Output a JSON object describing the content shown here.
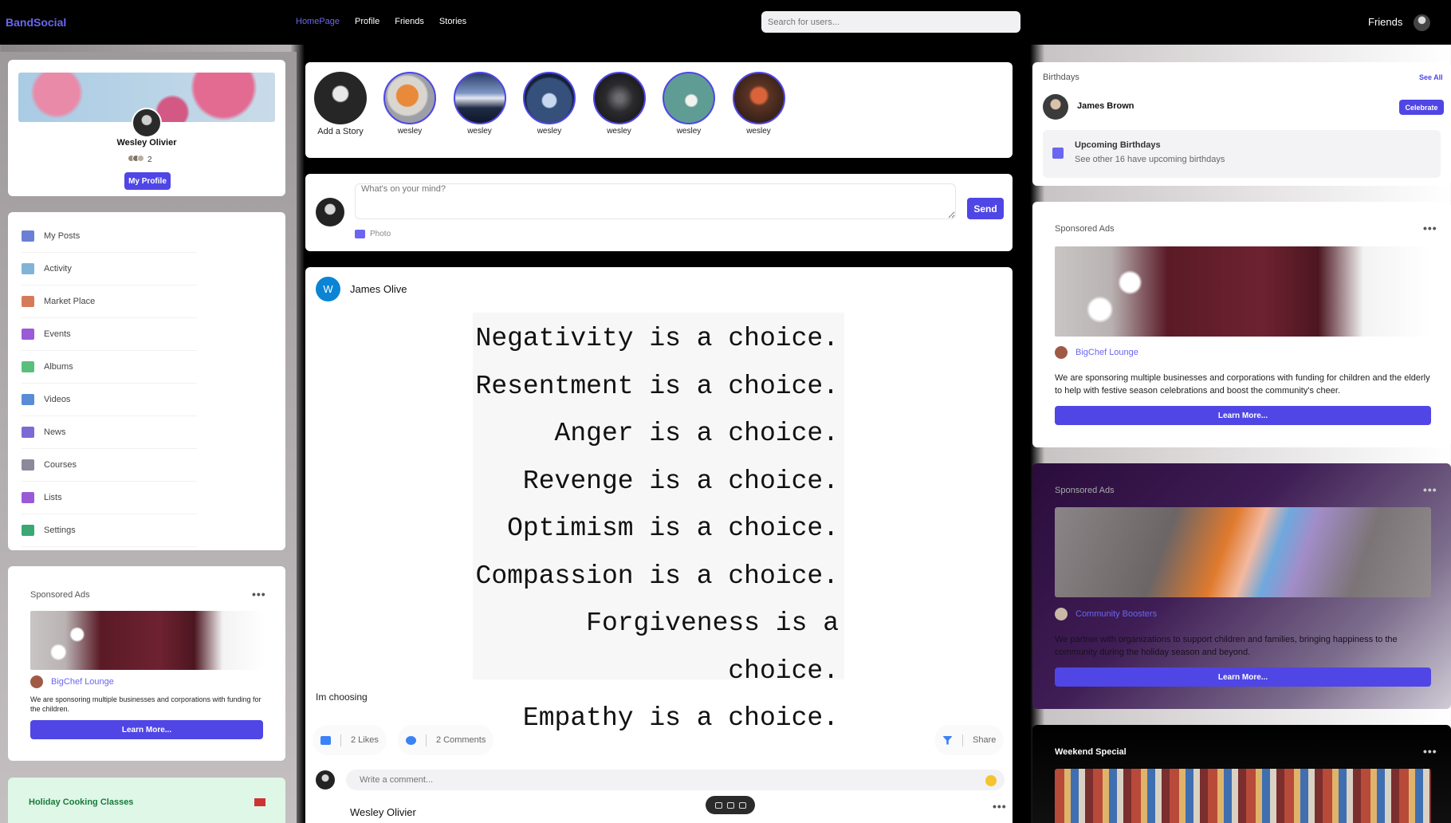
{
  "nav": {
    "brand": "BandSocial",
    "links": [
      "HomePage",
      "Profile",
      "Friends",
      "Stories"
    ],
    "search_placeholder": "Search for users...",
    "friends_label": "Friends"
  },
  "profile": {
    "name": "Wesley Olivier",
    "friend_count": "2",
    "button": "My Profile"
  },
  "menu": [
    {
      "label": "My Posts",
      "icon": "posts-icon",
      "color": "#6b7fd6"
    },
    {
      "label": "Activity",
      "icon": "activity-icon",
      "color": "#7fb4d6"
    },
    {
      "label": "Market Place",
      "icon": "marketplace-icon",
      "color": "#d67b5a"
    },
    {
      "label": "Events",
      "icon": "calendar-icon",
      "color": "#9b5ad6"
    },
    {
      "label": "Albums",
      "icon": "album-icon",
      "color": "#5abf7b"
    },
    {
      "label": "Videos",
      "icon": "video-icon",
      "color": "#5a8bd6"
    },
    {
      "label": "News",
      "icon": "news-icon",
      "color": "#7b6bd6"
    },
    {
      "label": "Courses",
      "icon": "courses-icon",
      "color": "#8a8a9a"
    },
    {
      "label": "Lists",
      "icon": "lists-icon",
      "color": "#9a5ad6"
    },
    {
      "label": "Settings",
      "icon": "settings-icon",
      "color": "#3aa873"
    }
  ],
  "left_ad": {
    "label": "Sponsored Ads",
    "brand": "BigChef Lounge",
    "text": "We are sponsoring multiple businesses and corporations with funding for the children.",
    "button": "Learn More..."
  },
  "holiday": {
    "title": "Holiday Cooking Classes"
  },
  "stories": {
    "add_label": "Add a Story",
    "items": [
      {
        "name": "wesley",
        "bg": "radial-gradient(circle at 45% 45%,#e98a3b 0 28%,#d9d5cf 30% 50%,#9c9fa6 55% 100%)"
      },
      {
        "name": "wesley",
        "bg": "linear-gradient(180deg,#2b3f6b 0,#7f96c4 40%,#e6e9f2 50%,#1f2b45 70%,#0f172a 100%)"
      },
      {
        "name": "wesley",
        "bg": "radial-gradient(circle at 50% 55%,#c7d8f0 0 18%,#35507a 22% 60%,#142239 65% 100%)"
      },
      {
        "name": "wesley",
        "bg": "radial-gradient(circle at 50% 50%,#6c6c70 0 10%,#2b2b2e 40%,#111 100%)"
      },
      {
        "name": "wesley",
        "bg": "radial-gradient(circle at 55% 55%,#f2f2ee 0 14%,#5f9c94 18% 100%)"
      },
      {
        "name": "wesley",
        "bg": "radial-gradient(circle at 50% 45%,#d9643a 0 20%,#5c3424 28%,#1f1512 100%)"
      }
    ]
  },
  "composer": {
    "placeholder": "What's on your mind?",
    "send": "Send",
    "photo": "Photo"
  },
  "post": {
    "author_initial": "W",
    "author": "James Olive",
    "quote_lines": [
      "Negativity is a choice.",
      "Resentment is a choice.",
      "Anger is a choice.",
      "Revenge is a choice.",
      "Optimism is a choice.",
      "Compassion is a choice.",
      "Forgiveness is a choice.",
      "Empathy is a choice."
    ],
    "caption": "Im choosing",
    "likes": "2 Likes",
    "comments": "2 Comments",
    "share": "Share",
    "comment_placeholder": "Write a comment...",
    "comment_author": "Wesley Olivier"
  },
  "birthdays": {
    "title": "Birthdays",
    "see_all": "See All",
    "name": "James Brown",
    "button": "Celebrate",
    "upcoming_title": "Upcoming Birthdays",
    "upcoming_sub": "See other 16 have upcoming birthdays"
  },
  "right_ad1": {
    "label": "Sponsored Ads",
    "brand": "BigChef Lounge",
    "text": "We are sponsoring multiple businesses and corporations with funding for children and the elderly to help with festive season celebrations and boost the community's cheer.",
    "button": "Learn More..."
  },
  "right_ad2": {
    "label": "Sponsored Ads",
    "brand": "Community Boosters",
    "text": "We partner with organizations to support children and families, bringing happiness to the community during the holiday season and beyond.",
    "button": "Learn More..."
  },
  "weekend": {
    "title": "Weekend Special"
  },
  "colors": {
    "accent": "#4f46e5",
    "brand": "#6b66f0"
  }
}
